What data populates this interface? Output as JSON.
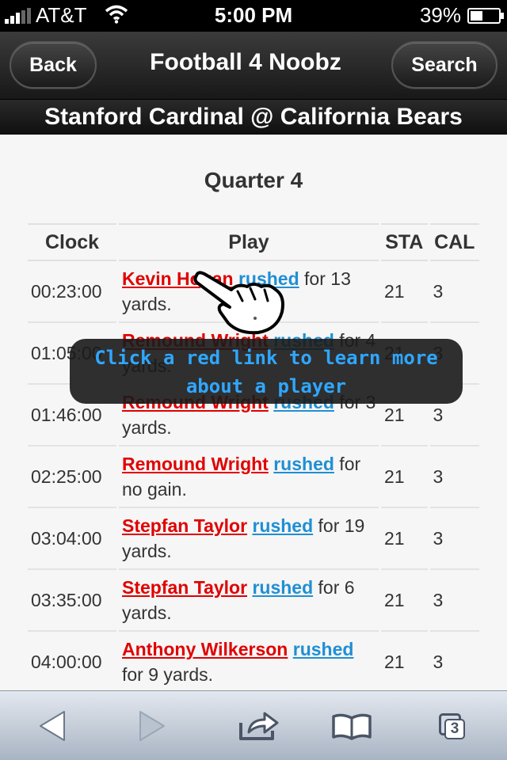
{
  "status_bar": {
    "carrier": "AT&T",
    "time": "5:00 PM",
    "battery": "39%",
    "battery_level": 0.39
  },
  "nav": {
    "back_label": "Back",
    "title": "Football 4 Noobz",
    "search_label": "Search"
  },
  "matchup": "Stanford Cardinal @ California Bears",
  "quarter": "Quarter 4",
  "table": {
    "headers": [
      "Clock",
      "Play",
      "STA",
      "CAL"
    ],
    "rows": [
      {
        "clock": "00:23:00",
        "player": "Kevin Hogan",
        "action": "rushed",
        "rest": " for 13 yards.",
        "sta": "21",
        "cal": "3"
      },
      {
        "clock": "01:05:00",
        "player": "Remound Wright",
        "action": "rushed",
        "rest": " for 4 yards.",
        "sta": "21",
        "cal": "3"
      },
      {
        "clock": "01:46:00",
        "player": "Remound Wright",
        "action": "rushed",
        "rest": " for 3 yards.",
        "sta": "21",
        "cal": "3"
      },
      {
        "clock": "02:25:00",
        "player": "Remound Wright",
        "action": "rushed",
        "rest": " for no gain.",
        "sta": "21",
        "cal": "3"
      },
      {
        "clock": "03:04:00",
        "player": "Stepfan Taylor",
        "action": "rushed",
        "rest": " for 19 yards.",
        "sta": "21",
        "cal": "3"
      },
      {
        "clock": "03:35:00",
        "player": "Stepfan Taylor",
        "action": "rushed",
        "rest": " for 6 yards.",
        "sta": "21",
        "cal": "3"
      },
      {
        "clock": "04:00:00",
        "player": "Anthony Wilkerson",
        "action": "rushed",
        "rest": " for 9 yards.",
        "sta": "21",
        "cal": "3"
      }
    ]
  },
  "tooltip": "Click a red link to learn more about a player",
  "toolbar": {
    "tabs_count": "3"
  },
  "colors": {
    "player_link": "#e00000",
    "action_link": "#1f8fd4",
    "tooltip_text": "#2fa7ff"
  },
  "icons": [
    "wifi-icon",
    "back-arrow-icon",
    "forward-arrow-icon",
    "share-icon",
    "bookmarks-icon",
    "tabs-icon",
    "pointing-hand-icon"
  ]
}
